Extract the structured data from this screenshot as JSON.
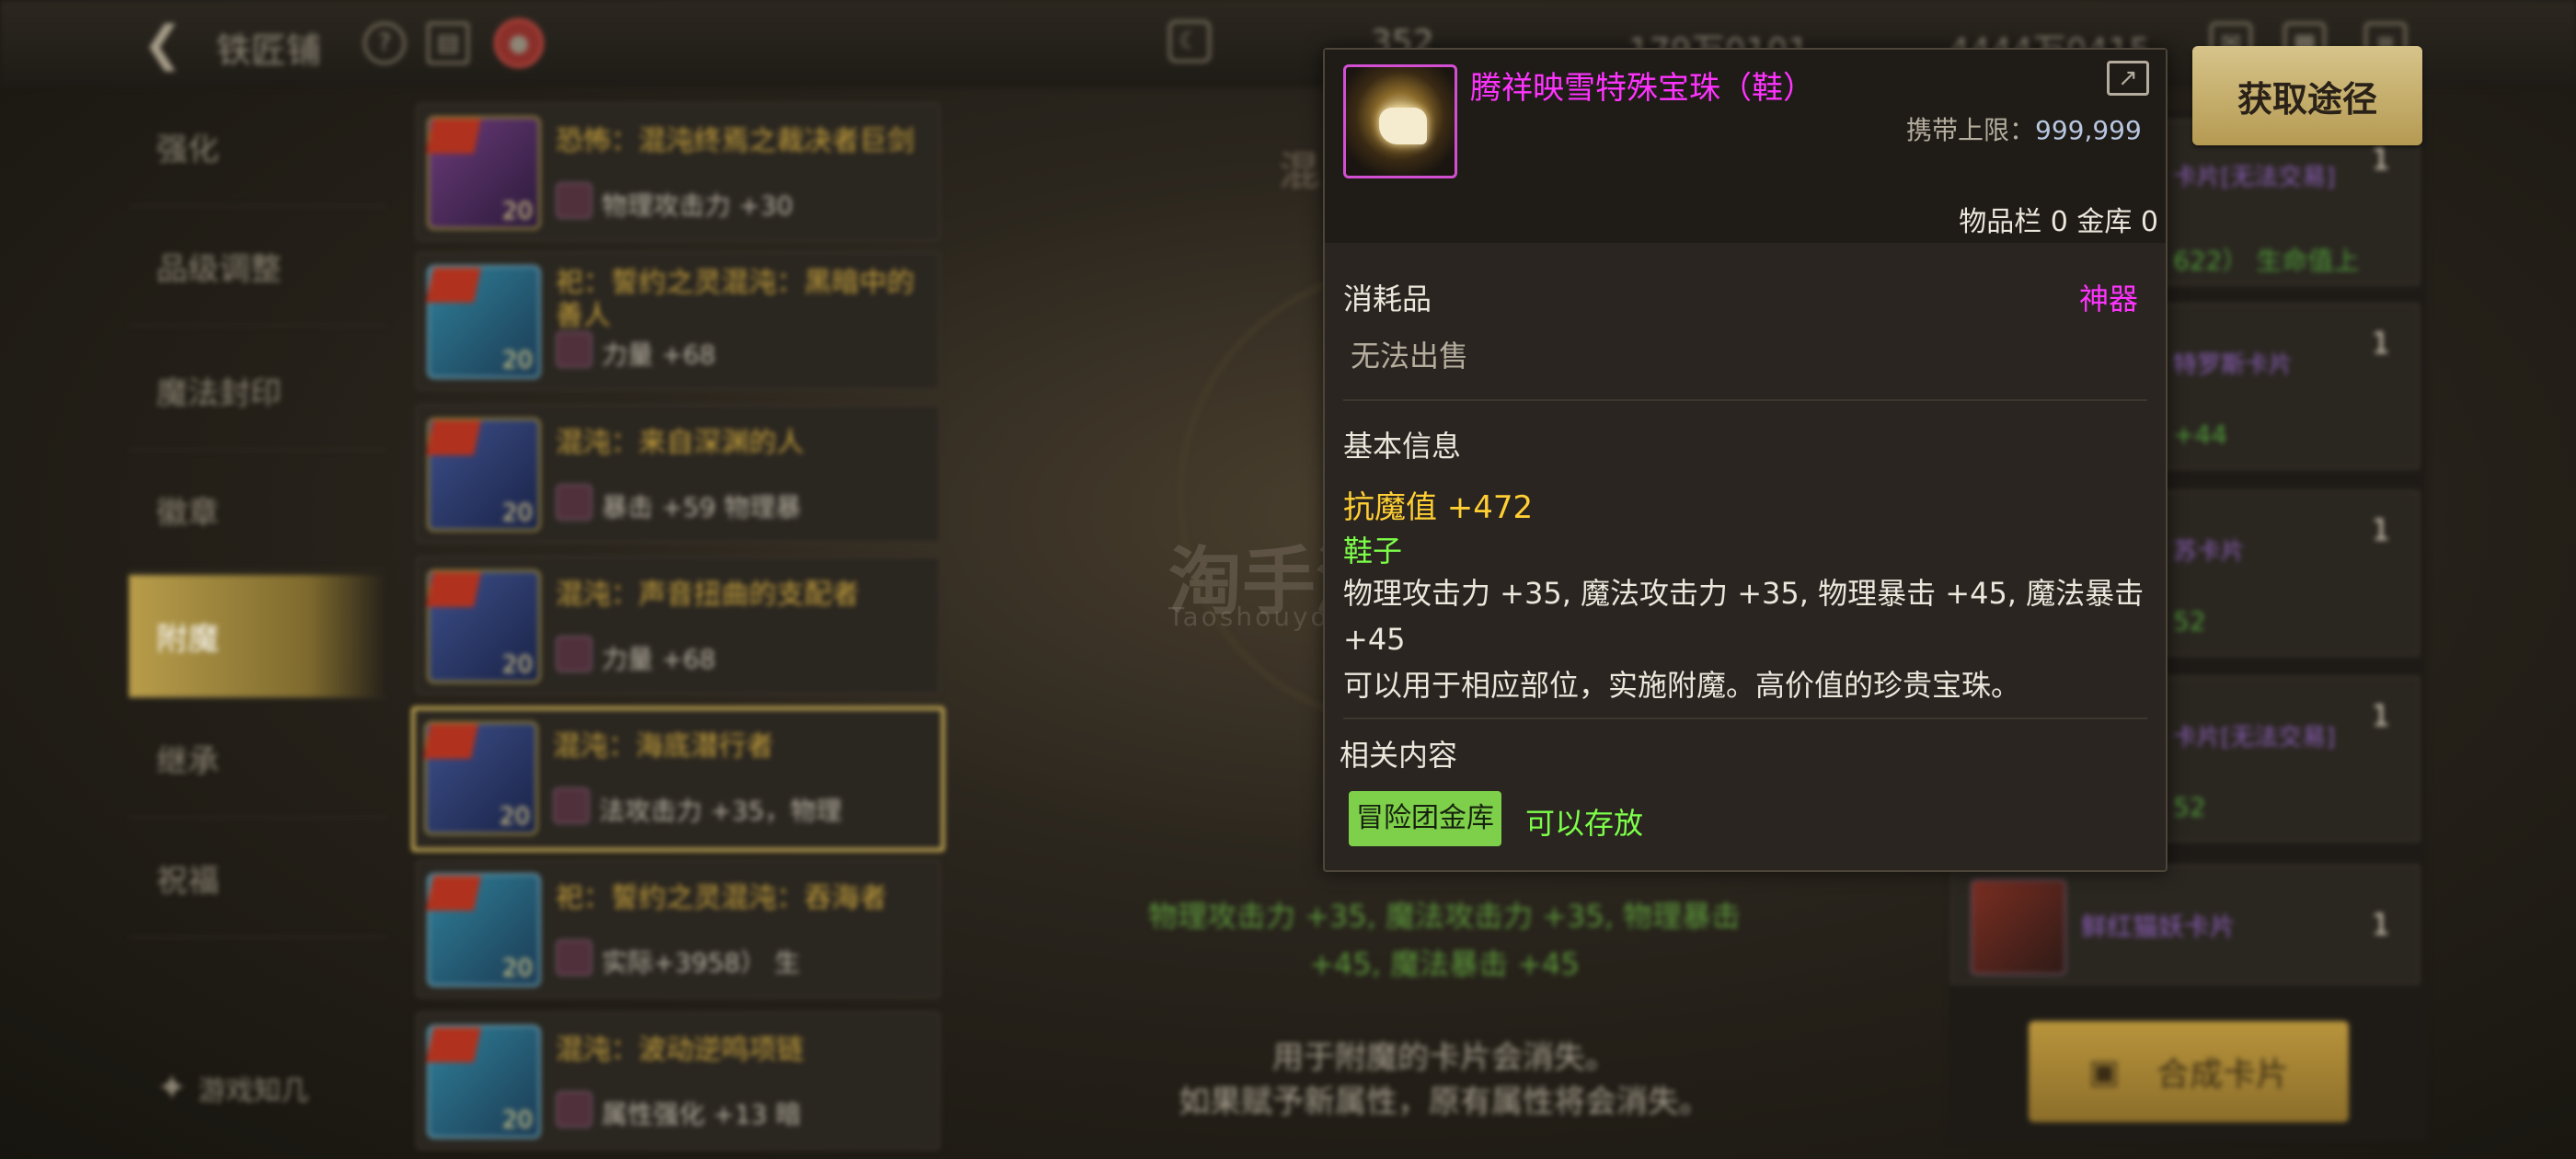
{
  "topbar": {
    "title": "铁匠铺",
    "res1": "352",
    "res2": "179万0101",
    "res3": "4444万0415"
  },
  "nav": [
    "强化",
    "品级调整",
    "魔法封印",
    "徽章",
    "附魔",
    "继承",
    "祝福"
  ],
  "nav_footer": "游戏知几",
  "cards": [
    {
      "name": "恐怖：混沌终焉之裁决者巨剑",
      "stat": "物理攻击力 +30",
      "lvl": "20"
    },
    {
      "name": "祀：誓约之灵混沌：黑暗中的善人",
      "stat": "力量 +68",
      "lvl": "20"
    },
    {
      "name": "混沌：来自深渊的人",
      "stat": "暴击 +59      物理暴",
      "lvl": "20"
    },
    {
      "name": "混沌：声音扭曲的支配者",
      "stat": "力量 +68",
      "lvl": "20"
    },
    {
      "name": "混沌：海底潜行者",
      "stat": "法攻击力 +35，物理",
      "lvl": "20"
    },
    {
      "name": "祀：誓约之灵混沌：吞海者",
      "stat": "实际+3958）      生",
      "lvl": "20"
    },
    {
      "name": "混沌：波动逆鸣项链",
      "stat": "属性强化 +13      暗",
      "lvl": "20"
    }
  ],
  "center": {
    "title": "混",
    "effect": "物理攻击力 +35, 魔法攻击力 +35, 物理暴击 +45, 魔法暴击 +45",
    "note1": "用于附魔的卡片会消失。",
    "note2": "如果赋予新属性，原有属性将会消失。"
  },
  "watermark": {
    "cn": "淘手游",
    "en": "Taoshouyou.com"
  },
  "right_rows": [
    {
      "name": "卡片[无法交易]",
      "sub": "622）    生命值上",
      "count": "1"
    },
    {
      "name": "特罗斯卡片",
      "sub": "+44",
      "count": "1"
    },
    {
      "name": "苏卡片",
      "sub": "52",
      "count": "1"
    },
    {
      "name": "卡片[无法交易]",
      "sub": "52",
      "count": "1"
    },
    {
      "name": "鲜红猫妖卡片",
      "sub": "",
      "count": "1"
    }
  ],
  "synth_button": "合成卡片",
  "get_button": "获取途径",
  "tooltip": {
    "title": "腾祥映雪特殊宝珠（鞋）",
    "limit_label": "携带上限：",
    "limit_value": "999,999",
    "storage": "物品栏 0 金库 0",
    "category": "消耗品",
    "rarity": "神器",
    "sell": "无法出售",
    "basic_info": "基本信息",
    "magic_def": "抗魔值 +472",
    "slot": "鞋子",
    "stats": "物理攻击力 +35, 魔法攻击力 +35, 物理暴击 +45, 魔法暴击 +45",
    "desc": "可以用于相应部位，实施附魔。高价值的珍贵宝珠。",
    "related": "相关内容",
    "tag": "冒险团金库",
    "tag_note": "可以存放"
  },
  "colors": {
    "rarity": "#ff33ff",
    "magic_def": "#ffcf33",
    "slot": "#7dff4a",
    "tag_bg": "#7ecf4a",
    "tag_note": "#7dff4a",
    "gold": "#c9ad55"
  }
}
